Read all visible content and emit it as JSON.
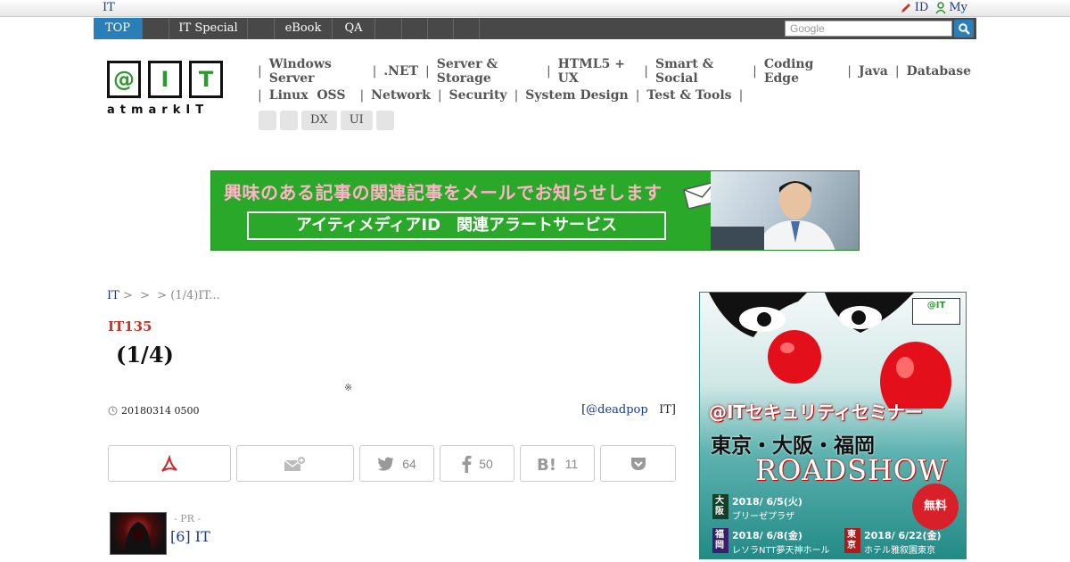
{
  "topbar": {
    "site": "IT",
    "id_label": "ID",
    "my_label": "My"
  },
  "gnav": {
    "tabs": [
      "TOP",
      "",
      "IT Special",
      "",
      "eBook",
      "QA",
      "",
      "",
      "",
      ""
    ],
    "search_placeholder": "Google"
  },
  "logo": {
    "boxes": [
      "@",
      "I",
      "T"
    ],
    "text": "atmarkIT"
  },
  "categories": {
    "row1": [
      "Windows Server",
      ".NET",
      "Server & Storage",
      "HTML5 + UX",
      "Smart & Social",
      "Coding Edge",
      "Java",
      "Database"
    ],
    "row2": [
      "Linux  OSS",
      "Network",
      "Security",
      "System Design",
      "Test & Tools"
    ]
  },
  "tags": [
    "",
    "",
    "DX",
    "UI",
    ""
  ],
  "banner": {
    "headline": "興味のある記事の関連記事をメールでお知らせします",
    "box": "アイティメディアID　関連アラートサービス"
  },
  "breadcrumb": {
    "first": "IT",
    "rest": " >  >  > (1/4)IT..."
  },
  "article": {
    "series": "IT135",
    "title": "(1/4)",
    "note": "※",
    "date": "20180314 0500",
    "author_prefix": "[",
    "author": "@deadpop",
    "author_suffix": "IT]"
  },
  "share": {
    "twitter": "64",
    "facebook": "50",
    "hatena": "11"
  },
  "pr": {
    "label": "- PR -",
    "title": "[6] IT"
  },
  "ad": {
    "logo": "@IT",
    "title": "@ITセキュリティセミナー",
    "cities": "東京・大阪・福岡",
    "roadshow": "ROADSHOW",
    "free": "無料",
    "events": [
      {
        "city": "大阪",
        "date": "2018/ 6/5(火)",
        "venue": "ブリーゼプラザ"
      },
      {
        "city": "福岡",
        "date": "2018/ 6/8(金)",
        "venue": "レソラNTT夢天神ホール"
      },
      {
        "city": "東京",
        "date": "2018/ 6/22(金)",
        "venue": "ホテル雅叙園東京"
      }
    ]
  },
  "colors": {
    "accent": "#2a7fb8",
    "series": "#c0392b",
    "link": "#1a3a8c",
    "banner": "#2aa82a"
  }
}
